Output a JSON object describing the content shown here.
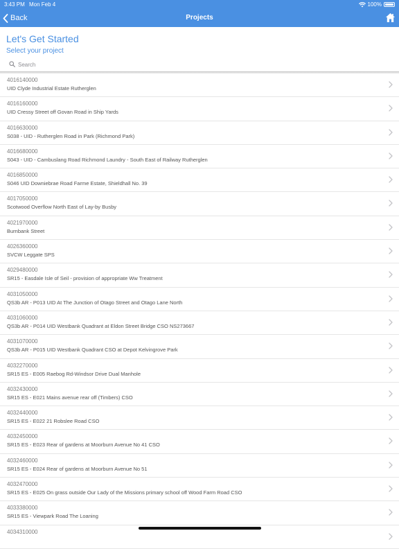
{
  "status_bar": {
    "time": "3:43 PM",
    "date": "Mon Feb 4",
    "battery": "100%"
  },
  "nav": {
    "back_label": "Back",
    "title": "Projects",
    "home_icon": "home-icon"
  },
  "header": {
    "title": "Let's Get Started",
    "subtitle": "Select your project"
  },
  "search": {
    "placeholder": "Search",
    "value": ""
  },
  "colors": {
    "accent": "#4a90e2"
  },
  "projects": [
    {
      "code": "4016140000",
      "name": "UID Clyde Industrial Estate Rutherglen"
    },
    {
      "code": "4016160000",
      "name": "UID Cressy Street off Govan Road in Ship Yards"
    },
    {
      "code": "4016630000",
      "name": "S038 - UID - Rutherglen Road in Park (Richmond Park)"
    },
    {
      "code": "4016680000",
      "name": "S043 - UID - Cambuslang Road Richmond Laundry - South East of Railway Rutherglen"
    },
    {
      "code": "4016850000",
      "name": "S046 UID Downiebrae Road Farme Estate, Shieldhall No. 39"
    },
    {
      "code": "4017050000",
      "name": "Scotwood Overflow North East of Lay-by Busby"
    },
    {
      "code": "4021970000",
      "name": "Burnbank Street"
    },
    {
      "code": "4026360000",
      "name": "SVCW Leggate SPS"
    },
    {
      "code": "4029480000",
      "name": "SR15 - Easdale Isle of Seil - provision of appropriate Ww Treatment"
    },
    {
      "code": "4031050000",
      "name": "QS3b AR - P013 UID At The Junction of Otago Street and Otago Lane North"
    },
    {
      "code": "4031060000",
      "name": "QS3b AR - P014 UID Westbank Quadrant at Eldon Street Bridge CSO NS273667"
    },
    {
      "code": "4031070000",
      "name": "QS3b AR - P015 UID Westbank Quadrant CSO at Depot Kelvingrove Park"
    },
    {
      "code": "4032270000",
      "name": "SR15 ES - E005 Raebog Rd-Windsor Drive Dual Manhole"
    },
    {
      "code": "4032430000",
      "name": "SR15 ES - E021 Mains avenue rear off (Timbers) CSO"
    },
    {
      "code": "4032440000",
      "name": "SR15 ES - E022 21 Robslee Road CSO"
    },
    {
      "code": "4032450000",
      "name": "SR15 ES - E023 Rear of gardens at Moorburn Avenue No 41 CSO"
    },
    {
      "code": "4032460000",
      "name": "SR15 ES - E024 Rear of gardens at Moorburn Avenue No 51"
    },
    {
      "code": "4032470000",
      "name": "SR15 ES - E025 On grass outside Our Lady of the Missions primary school off Wood Farm Road CSO"
    },
    {
      "code": "4033380000",
      "name": "SR15 ES - Viewpark Road The Loaning"
    },
    {
      "code": "4034310000",
      "name": ""
    }
  ]
}
